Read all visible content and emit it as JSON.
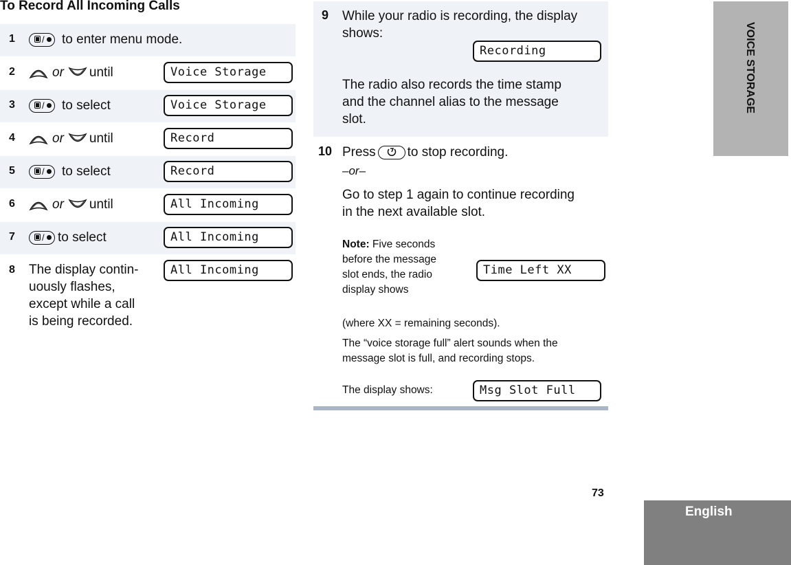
{
  "page": {
    "title": "To Record All Incoming Calls",
    "page_number": "73",
    "side_tab": "VOICE STORAGE",
    "language_tab": "English",
    "colors": {
      "band": "#eff3f7",
      "side_tab": "#b3b3b3",
      "language_tab": "#808080",
      "rule": "#a9b6c8"
    }
  },
  "steps": [
    {
      "num": "1",
      "icon": "menu-select-key",
      "text": "to enter menu mode.",
      "display": ""
    },
    {
      "num": "2",
      "icon": "up-down-keys",
      "or": "or",
      "text": "until",
      "display": "Voice Storage"
    },
    {
      "num": "3",
      "icon": "menu-select-key",
      "text": "to select",
      "display": "Voice Storage"
    },
    {
      "num": "4",
      "icon": "up-down-keys",
      "or": "or",
      "text": "until",
      "display": "Record"
    },
    {
      "num": "5",
      "icon": "menu-select-key",
      "text": "to select",
      "display": "Record"
    },
    {
      "num": "6",
      "icon": "up-down-keys",
      "or": "or",
      "text": "until",
      "display": "All Incoming"
    },
    {
      "num": "7",
      "icon": "menu-select-key",
      "text": "to select",
      "display": "All Incoming"
    },
    {
      "num": "8",
      "text_lines": [
        "The display contin-",
        "uously flashes,",
        "except while a call",
        "is being recorded."
      ],
      "display": "All Incoming"
    }
  ],
  "step9": {
    "num": "9",
    "text": "While your radio is recording, the display shows:",
    "display": "Recording",
    "text2_lines": [
      "The radio also records the time stamp",
      "and the channel alias to the message",
      "slot."
    ]
  },
  "step10": {
    "num": "10",
    "press": "Press",
    "icon": "home-key",
    "after": "to stop recording.",
    "or": "–or–",
    "alt_lines": [
      "Go to step 1 again to continue recording",
      "in the next available slot."
    ]
  },
  "note": {
    "label": "Note:",
    "lines": [
      " Five seconds",
      "before the message",
      "slot ends, the radio",
      "display shows"
    ],
    "display": "Time Left XX",
    "where": "(where XX = remaining seconds).",
    "alert_lines": [
      "The “voice storage full” alert sounds when the",
      "message slot is full, and recording stops."
    ],
    "display_label": "The display shows:",
    "display2": "Msg Slot Full"
  }
}
